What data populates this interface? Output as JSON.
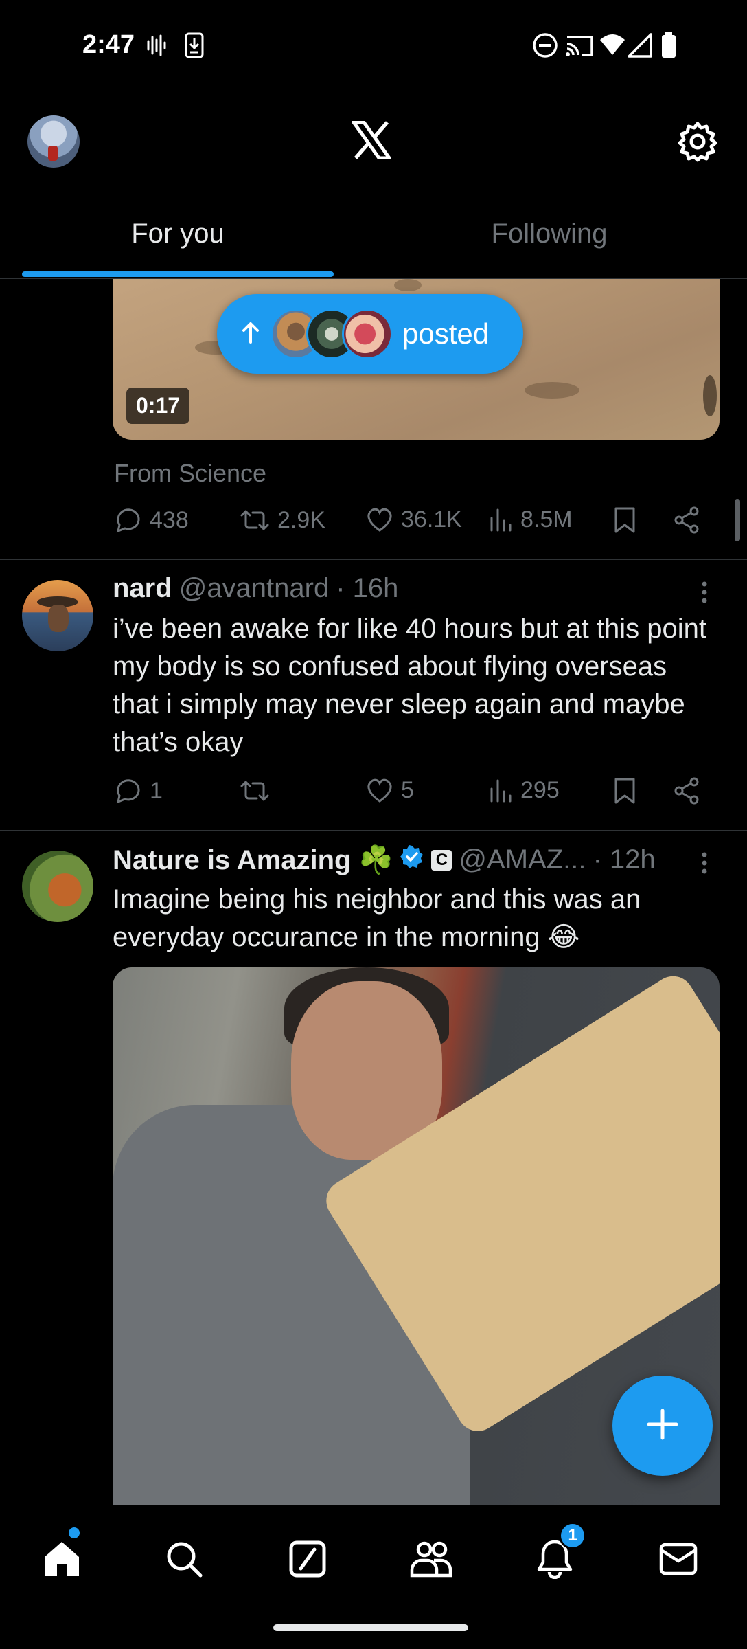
{
  "status_bar": {
    "time": "2:47",
    "icons": [
      "voicemail-icon",
      "download-icon",
      "do-not-disturb-icon",
      "cast-icon",
      "wifi-icon",
      "signal-icon",
      "battery-icon"
    ]
  },
  "header": {
    "logo": "X",
    "settings_icon": "gear-icon"
  },
  "tabs": [
    {
      "label": "For you",
      "active": true
    },
    {
      "label": "Following",
      "active": false
    }
  ],
  "pill": {
    "label": "posted"
  },
  "post_prev": {
    "video_duration": "0:17",
    "from_line": "From Science",
    "replies": "438",
    "reposts": "2.9K",
    "likes": "36.1K",
    "views": "8.5M"
  },
  "post_nard": {
    "name": "nard",
    "handle": "@avantnard",
    "time": "· 16h",
    "text": "i’ve been awake for like 40 hours but at this point my body is so confused about flying overseas that i simply may never sleep again and maybe that’s okay",
    "replies": "1",
    "reposts": "",
    "likes": "5",
    "views": "295"
  },
  "post_nature": {
    "name": "Nature is Amazing ☘️",
    "handle": "@AMAZ...",
    "time": "· 12h",
    "badge_letter": "C",
    "text": "Imagine being his neighbor and this was an everyday occurance in the morning 😂"
  },
  "bottom_nav": {
    "items": [
      "home-icon",
      "search-icon",
      "grok-icon",
      "communities-icon",
      "notifications-icon",
      "messages-icon"
    ],
    "notification_count": "1"
  },
  "colors": {
    "accent": "#1d9bf0",
    "muted": "#71767b",
    "background": "#000000"
  }
}
